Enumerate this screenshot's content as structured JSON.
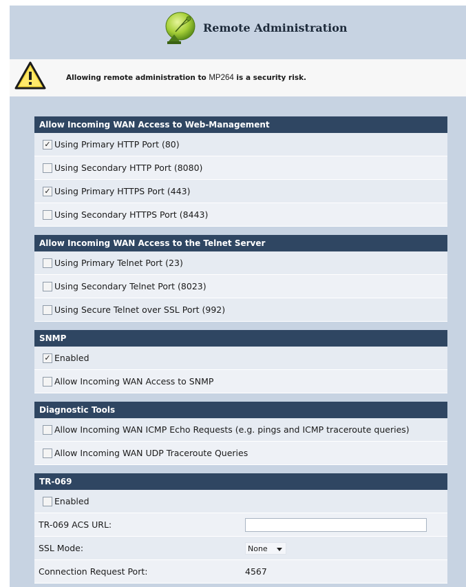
{
  "header": {
    "title": "Remote Administration",
    "icon": "satellite-dish-icon"
  },
  "warning": {
    "icon": "warning-triangle-icon",
    "prefix": "Allowing remote administration to ",
    "device": "MP264",
    "suffix": " is a security risk."
  },
  "sections": {
    "web": {
      "title": "Allow Incoming WAN Access to Web-Management",
      "items": [
        {
          "label": "Using Primary HTTP Port (80)",
          "checked": true
        },
        {
          "label": "Using Secondary HTTP Port (8080)",
          "checked": false
        },
        {
          "label": "Using Primary HTTPS Port (443)",
          "checked": true
        },
        {
          "label": "Using Secondary HTTPS Port (8443)",
          "checked": false
        }
      ]
    },
    "telnet": {
      "title": "Allow Incoming WAN Access to the Telnet Server",
      "items": [
        {
          "label": "Using Primary Telnet Port (23)",
          "checked": false
        },
        {
          "label": "Using Secondary Telnet Port (8023)",
          "checked": false
        },
        {
          "label": "Using Secure Telnet over SSL Port (992)",
          "checked": false
        }
      ]
    },
    "snmp": {
      "title": "SNMP",
      "items": [
        {
          "label": "Enabled",
          "checked": true
        },
        {
          "label": "Allow Incoming WAN Access to SNMP",
          "checked": false
        }
      ]
    },
    "diag": {
      "title": "Diagnostic Tools",
      "items": [
        {
          "label": "Allow Incoming WAN ICMP Echo Requests (e.g. pings and ICMP traceroute queries)",
          "checked": false
        },
        {
          "label": "Allow Incoming WAN UDP Traceroute Queries",
          "checked": false
        }
      ]
    },
    "tr069": {
      "title": "TR-069",
      "enabled": {
        "label": "Enabled",
        "checked": false
      },
      "acs_url": {
        "label": "TR-069 ACS URL:",
        "value": ""
      },
      "ssl_mode": {
        "label": "SSL Mode:",
        "value": "None"
      },
      "conn_port": {
        "label": "Connection Request Port:",
        "value": "4567"
      }
    }
  },
  "colors": {
    "page_bg": "#c7d3e2",
    "section_header_bg": "#2f4662",
    "row_bg": "#e6ebf2"
  }
}
